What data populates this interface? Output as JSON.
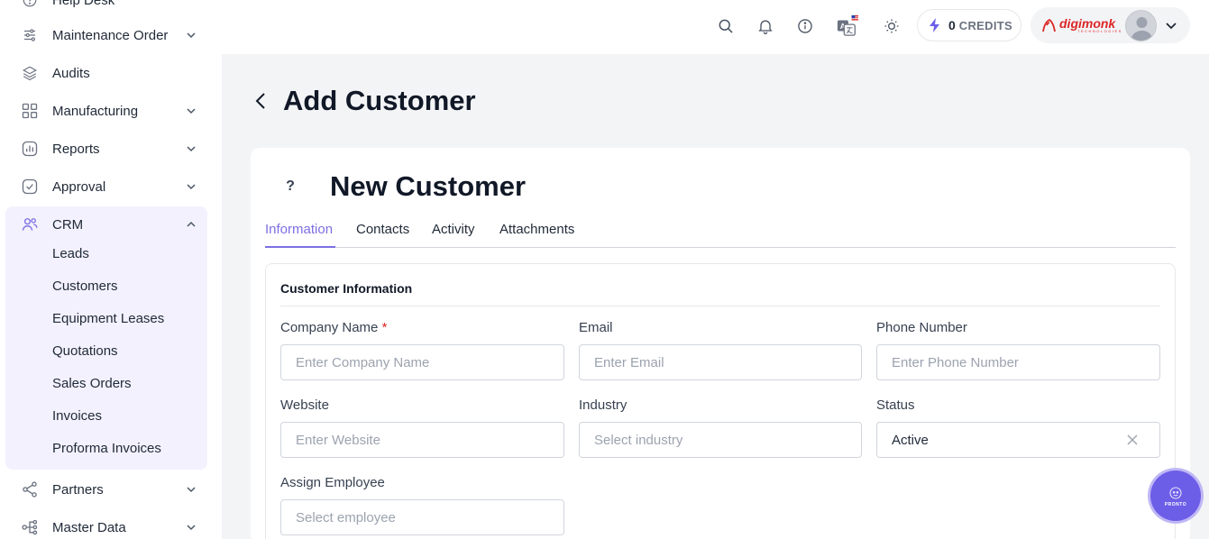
{
  "sidebar": {
    "items": [
      {
        "label": "Help Desk",
        "icon": "help-circle-icon",
        "expandable": false
      },
      {
        "label": "Maintenance Order",
        "icon": "sliders-icon",
        "expandable": true
      },
      {
        "label": "Audits",
        "icon": "layers-icon",
        "expandable": false
      },
      {
        "label": "Manufacturing",
        "icon": "grid-icon",
        "expandable": true
      },
      {
        "label": "Reports",
        "icon": "bar-chart-icon",
        "expandable": true
      },
      {
        "label": "Approval",
        "icon": "check-square-icon",
        "expandable": true
      },
      {
        "label": "CRM",
        "icon": "users-icon",
        "expandable": true,
        "expanded": true
      },
      {
        "label": "Partners",
        "icon": "share-icon",
        "expandable": true
      },
      {
        "label": "Master Data",
        "icon": "hierarchy-icon",
        "expandable": true
      }
    ],
    "crm_sub_items": [
      {
        "label": "Leads"
      },
      {
        "label": "Customers"
      },
      {
        "label": "Equipment Leases"
      },
      {
        "label": "Quotations"
      },
      {
        "label": "Sales Orders"
      },
      {
        "label": "Invoices"
      },
      {
        "label": "Proforma Invoices"
      }
    ]
  },
  "header": {
    "credits_count": "0",
    "credits_label": "CREDITS",
    "brand_name": "digimonk",
    "brand_sub": "TECHNOLOGIES",
    "icons": [
      "search-icon",
      "bell-icon",
      "info-icon",
      "translate-icon",
      "sun-icon"
    ]
  },
  "page": {
    "title": "Add Customer"
  },
  "card": {
    "avatar_placeholder": "?",
    "title": "New Customer",
    "tabs": [
      {
        "label": "Information",
        "active": true
      },
      {
        "label": "Contacts",
        "active": false
      },
      {
        "label": "Activity",
        "active": false
      },
      {
        "label": "Attachments",
        "active": false
      }
    ]
  },
  "form": {
    "section_title": "Customer Information",
    "company_name": {
      "label": "Company Name",
      "required_mark": "*",
      "placeholder": "Enter Company Name",
      "value": ""
    },
    "email": {
      "label": "Email",
      "placeholder": "Enter Email",
      "value": ""
    },
    "phone": {
      "label": "Phone Number",
      "placeholder": "Enter Phone Number",
      "value": ""
    },
    "website": {
      "label": "Website",
      "placeholder": "Enter Website",
      "value": ""
    },
    "industry": {
      "label": "Industry",
      "placeholder": "Select industry"
    },
    "status": {
      "label": "Status",
      "value": "Active"
    },
    "assign_employee": {
      "label": "Assign Employee",
      "placeholder": "Select employee"
    }
  },
  "fab": {
    "label": "PRONTO"
  },
  "colors": {
    "accent": "#7c6fe3",
    "crm_group_bg": "#f3f1fd",
    "brand_red": "#dc2626",
    "fab": "#6d5ee8"
  }
}
